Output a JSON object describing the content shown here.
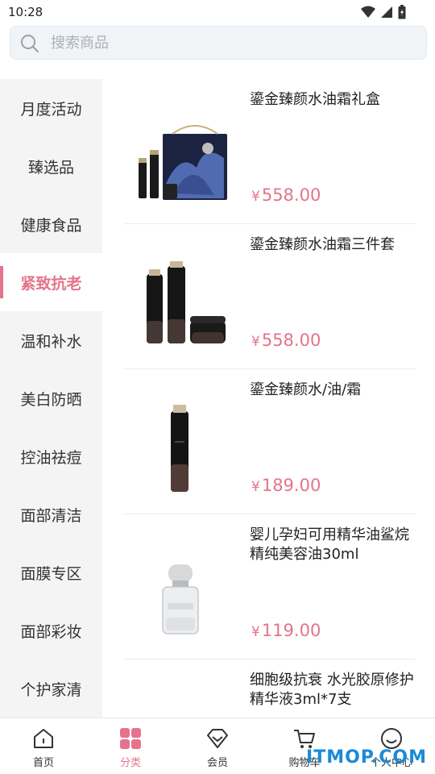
{
  "status_bar": {
    "time": "10:28"
  },
  "search": {
    "placeholder": "搜索商品"
  },
  "sidebar": {
    "items": [
      {
        "label": "月度活动"
      },
      {
        "label": "臻选品"
      },
      {
        "label": "健康食品"
      },
      {
        "label": "紧致抗老",
        "active": true
      },
      {
        "label": "温和补水"
      },
      {
        "label": "美白防晒"
      },
      {
        "label": "控油祛痘"
      },
      {
        "label": "面部清洁"
      },
      {
        "label": "面膜专区"
      },
      {
        "label": "面部彩妆"
      },
      {
        "label": "个护家清"
      }
    ]
  },
  "products": [
    {
      "name": "鎏金臻颜水油霜礼盒",
      "currency": "¥",
      "price": "558.00"
    },
    {
      "name": "鎏金臻颜水油霜三件套",
      "currency": "¥",
      "price": "558.00"
    },
    {
      "name": "鎏金臻颜水/油/霜",
      "currency": "¥",
      "price": "189.00"
    },
    {
      "name": "婴儿孕妇可用精华油鲨烷精纯美容油30ml",
      "currency": "¥",
      "price": "119.00"
    },
    {
      "name": "细胞级抗衰 水光胶原修护精华液3ml*7支",
      "currency": "",
      "price": ""
    }
  ],
  "bottom_nav": {
    "items": [
      {
        "label": "首页",
        "icon": "home-icon"
      },
      {
        "label": "分类",
        "icon": "category-icon",
        "active": true
      },
      {
        "label": "会员",
        "icon": "member-icon"
      },
      {
        "label": "购物车",
        "icon": "cart-icon"
      },
      {
        "label": "个人中心",
        "icon": "profile-icon"
      }
    ]
  },
  "watermark": "ITMOP.COM",
  "colors": {
    "accent": "#e5738b",
    "sidebar_bg": "#f4f4f4",
    "search_bg": "#f1f4f7"
  }
}
